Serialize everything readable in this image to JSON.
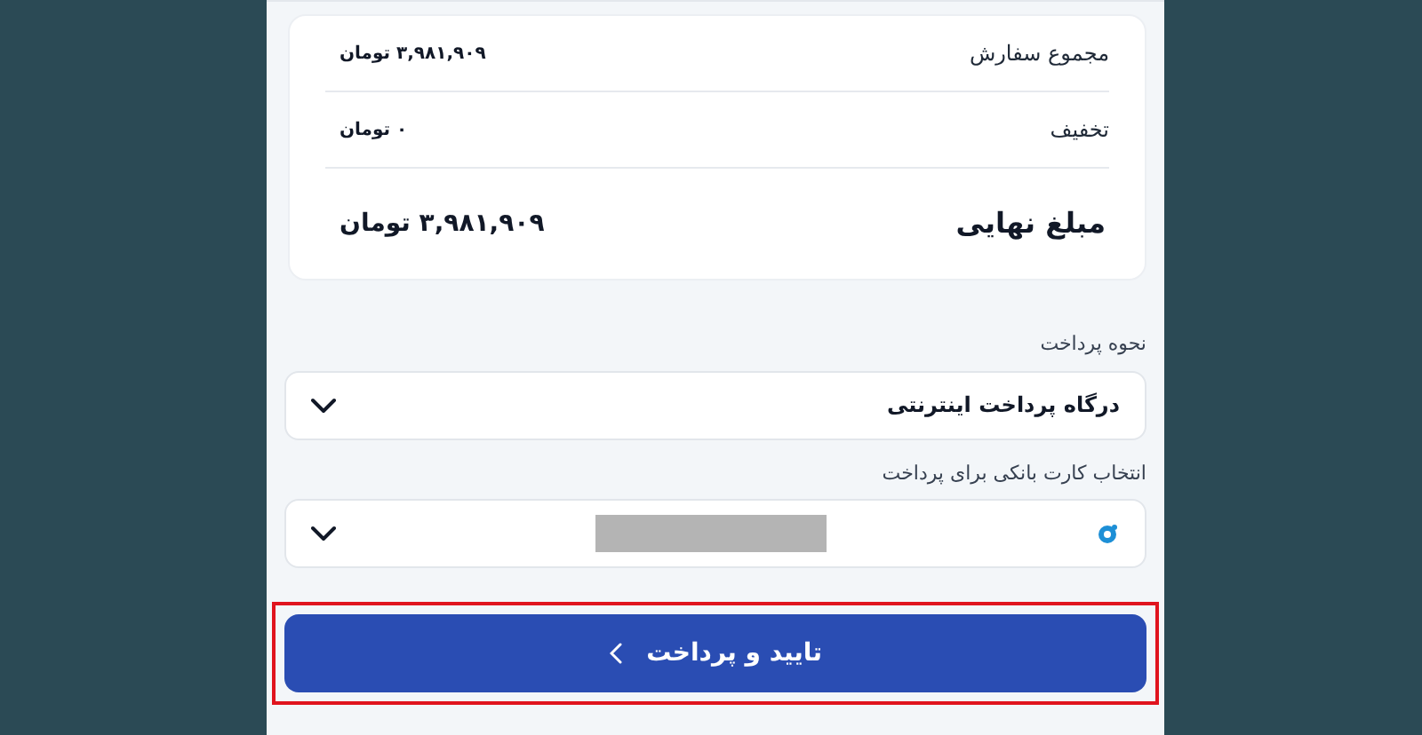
{
  "summary": {
    "rows": [
      {
        "kind": "line",
        "label": "مجموع سفارش",
        "value": "۳,۹۸۱,۹۰۹ تومان"
      },
      {
        "kind": "line",
        "label": "تخفیف",
        "value": "۰ تومان"
      },
      {
        "kind": "total",
        "label": "مبلغ نهایی",
        "value": "۳,۹۸۱,۹۰۹ تومان"
      }
    ]
  },
  "payment_method": {
    "label": "نحوه پرداخت",
    "value": "درگاه پرداخت اینترنتی"
  },
  "bank_card": {
    "label": "انتخاب کارت بانکی برای پرداخت",
    "redacted": true
  },
  "submit_button": {
    "label": "تایید و پرداخت",
    "highlighted": true
  }
}
